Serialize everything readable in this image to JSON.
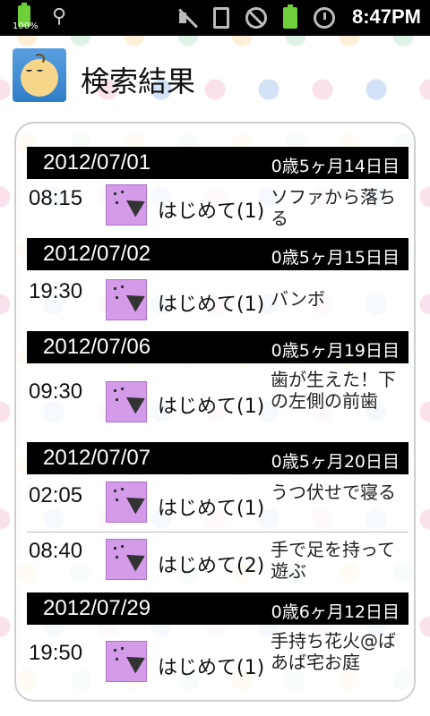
{
  "status_bar": {
    "battery_percent": "100%",
    "time": "8:47PM",
    "icons": [
      "battery-icon",
      "usb-icon",
      "mute-icon",
      "vibrate-icon",
      "no-signal-icon",
      "battery-icon",
      "alarm-icon"
    ]
  },
  "header": {
    "title": "検索結果",
    "app_icon": "baby-face-icon"
  },
  "results": [
    {
      "date": "2012/07/01",
      "age": "0歳5ヶ月14日目",
      "entries": [
        {
          "time": "08:15",
          "icon": "party-popper-icon",
          "type": "はじめて(1)",
          "desc": "ソファから落ちる"
        }
      ]
    },
    {
      "date": "2012/07/02",
      "age": "0歳5ヶ月15日目",
      "entries": [
        {
          "time": "19:30",
          "icon": "party-popper-icon",
          "type": "はじめて(1)",
          "desc": "バンボ"
        }
      ]
    },
    {
      "date": "2012/07/06",
      "age": "0歳5ヶ月19日目",
      "entries": [
        {
          "time": "09:30",
          "icon": "party-popper-icon",
          "type": "はじめて(1)",
          "desc": "歯が生えた！下の左側の前歯"
        }
      ]
    },
    {
      "date": "2012/07/07",
      "age": "0歳5ヶ月20日目",
      "entries": [
        {
          "time": "02:05",
          "icon": "party-popper-icon",
          "type": "はじめて(1)",
          "desc": "うつ伏せで寝る"
        },
        {
          "time": "08:40",
          "icon": "party-popper-icon",
          "type": "はじめて(2)",
          "desc": "手で足を持って遊ぶ"
        }
      ]
    },
    {
      "date": "2012/07/29",
      "age": "0歳6ヶ月12日目",
      "entries": [
        {
          "time": "19:50",
          "icon": "party-popper-icon",
          "type": "はじめて(1)",
          "desc": "手持ち花火@ばあば宅お庭"
        }
      ]
    }
  ],
  "colors": {
    "date_header_bg": "#000000",
    "category_icon_bg": "#d49be8",
    "status_bar_bg": "#000000"
  }
}
